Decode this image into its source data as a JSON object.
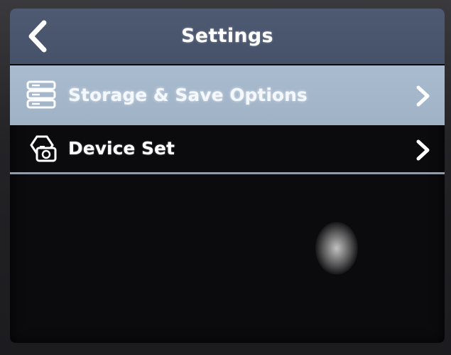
{
  "header": {
    "title": "Settings",
    "back_icon": "chevron-left-icon"
  },
  "menu": {
    "items": [
      {
        "label": "Storage & Save Options",
        "icon": "storage-list-icon",
        "selected": true
      },
      {
        "label": "Device Set",
        "icon": "device-camera-icon",
        "selected": false
      }
    ]
  },
  "colors": {
    "title_bar": "#4d5a72",
    "selected_row": "#a9bccf",
    "screen_background": "#0b0b0d",
    "text": "#ffffff"
  }
}
